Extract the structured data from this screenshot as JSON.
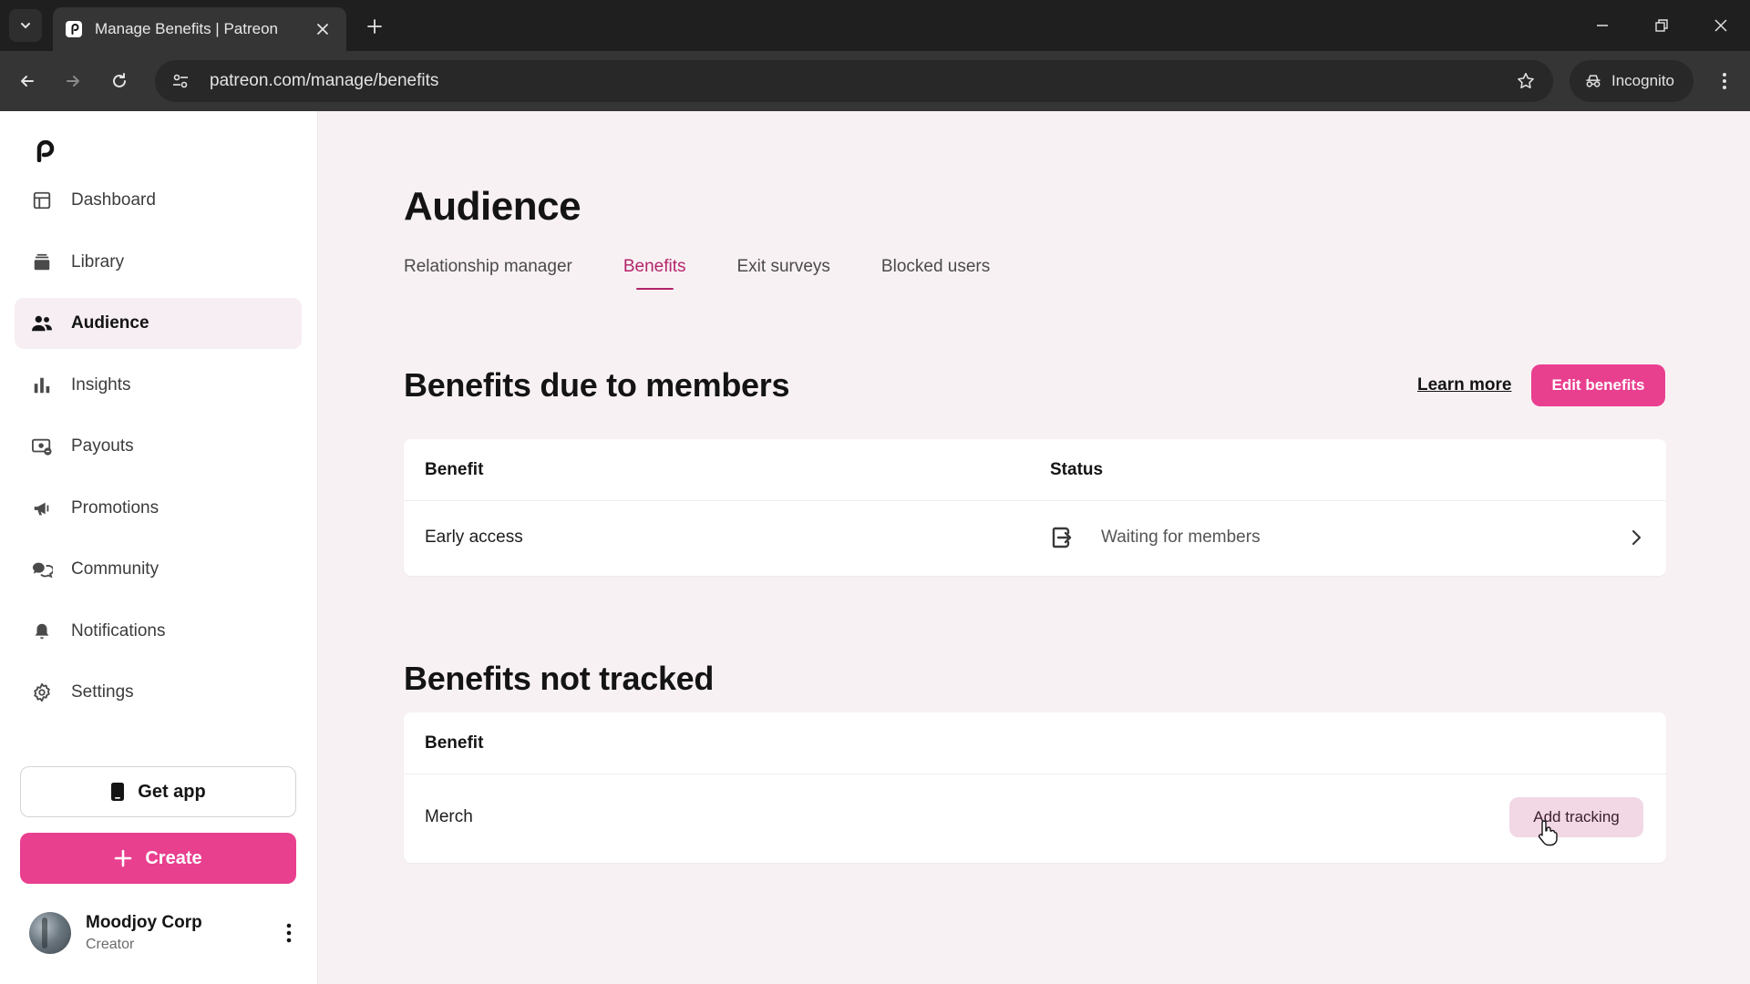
{
  "browser": {
    "tab_title": "Manage Benefits | Patreon",
    "url": "patreon.com/manage/benefits",
    "incognito_label": "Incognito"
  },
  "sidebar": {
    "items": [
      {
        "label": "Dashboard",
        "icon": "dashboard-icon"
      },
      {
        "label": "Library",
        "icon": "library-icon"
      },
      {
        "label": "Audience",
        "icon": "audience-icon",
        "active": true
      },
      {
        "label": "Insights",
        "icon": "insights-icon"
      },
      {
        "label": "Payouts",
        "icon": "payouts-icon"
      },
      {
        "label": "Promotions",
        "icon": "promotions-icon"
      },
      {
        "label": "Community",
        "icon": "community-icon"
      },
      {
        "label": "Notifications",
        "icon": "bell-icon"
      },
      {
        "label": "Settings",
        "icon": "gear-icon"
      }
    ],
    "get_app_label": "Get app",
    "create_label": "Create",
    "user": {
      "name": "Moodjoy Corp",
      "role": "Creator"
    }
  },
  "main": {
    "title": "Audience",
    "tabs": [
      {
        "label": "Relationship manager"
      },
      {
        "label": "Benefits",
        "active": true
      },
      {
        "label": "Exit surveys"
      },
      {
        "label": "Blocked users"
      }
    ],
    "due_section": {
      "title": "Benefits due to members",
      "learn_more": "Learn more",
      "edit_button": "Edit benefits",
      "columns": [
        "Benefit",
        "Status"
      ],
      "rows": [
        {
          "benefit": "Early access",
          "status": "Waiting for members"
        }
      ]
    },
    "not_tracked_section": {
      "title": "Benefits not tracked",
      "columns": [
        "Benefit"
      ],
      "rows": [
        {
          "benefit": "Merch",
          "action": "Add tracking"
        }
      ]
    }
  },
  "colors": {
    "accent": "#e93f8f",
    "active_tab": "#b3246a",
    "page_bg": "#f8f1f4",
    "add_tracking_bg": "#f1d8e4"
  }
}
